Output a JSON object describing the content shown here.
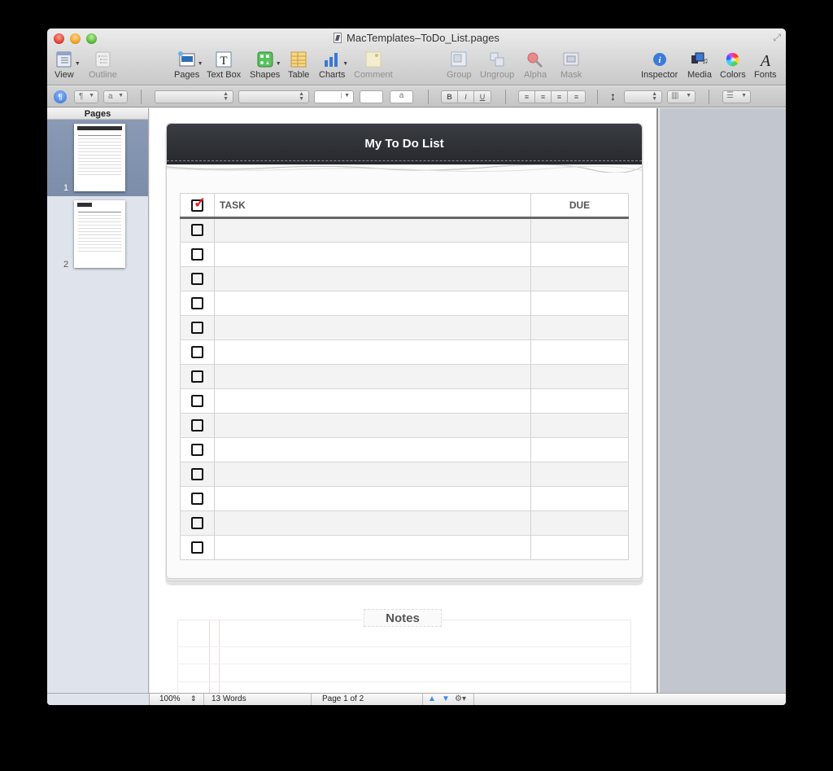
{
  "window": {
    "title": "MacTemplates–ToDo_List.pages"
  },
  "toolbar": {
    "items": [
      {
        "id": "view",
        "label": "View",
        "icon": "view-icon",
        "enabled": true,
        "menu": true
      },
      {
        "id": "outline",
        "label": "Outline",
        "icon": "outline-icon",
        "enabled": false,
        "menu": false
      },
      {
        "id": "pages",
        "label": "Pages",
        "icon": "pages-icon",
        "enabled": true,
        "menu": true
      },
      {
        "id": "textbox",
        "label": "Text Box",
        "icon": "text-box-icon",
        "enabled": true,
        "menu": false
      },
      {
        "id": "shapes",
        "label": "Shapes",
        "icon": "shapes-icon",
        "enabled": true,
        "menu": true
      },
      {
        "id": "table",
        "label": "Table",
        "icon": "table-icon",
        "enabled": true,
        "menu": false
      },
      {
        "id": "charts",
        "label": "Charts",
        "icon": "charts-icon",
        "enabled": true,
        "menu": true
      },
      {
        "id": "comment",
        "label": "Comment",
        "icon": "comment-icon",
        "enabled": false,
        "menu": false
      },
      {
        "id": "group",
        "label": "Group",
        "icon": "group-icon",
        "enabled": false,
        "menu": false
      },
      {
        "id": "ungroup",
        "label": "Ungroup",
        "icon": "ungroup-icon",
        "enabled": false,
        "menu": false
      },
      {
        "id": "alpha",
        "label": "Alpha",
        "icon": "alpha-icon",
        "enabled": false,
        "menu": false
      },
      {
        "id": "mask",
        "label": "Mask",
        "icon": "mask-icon",
        "enabled": false,
        "menu": false
      },
      {
        "id": "inspector",
        "label": "Inspector",
        "icon": "info-icon",
        "enabled": true,
        "menu": false
      },
      {
        "id": "media",
        "label": "Media",
        "icon": "media-icon",
        "enabled": true,
        "menu": false
      },
      {
        "id": "colors",
        "label": "Colors",
        "icon": "color-wheel-icon",
        "enabled": true,
        "menu": false
      },
      {
        "id": "fonts",
        "label": "Fonts",
        "icon": "fonts-icon",
        "enabled": true,
        "menu": false
      }
    ]
  },
  "format_bar": {
    "paragraph_style_glyph": "¶",
    "char_style_glyph": "a",
    "font_family_value": "",
    "font_typeface_value": "",
    "font_size_value": "",
    "text_color_value": "",
    "background_glyph": "a",
    "bold_label": "B",
    "italic_label": "I",
    "underline_label": "U",
    "line_spacing_value": ""
  },
  "sidebar": {
    "header": "Pages",
    "pages": [
      {
        "number": "1",
        "selected": true
      },
      {
        "number": "2",
        "selected": false
      }
    ]
  },
  "document": {
    "title": "My To Do List",
    "table": {
      "headers": {
        "check": "",
        "task": "TASK",
        "due": "DUE"
      },
      "header_checked": true,
      "rows": [
        {
          "checked": false,
          "task": "",
          "due": ""
        },
        {
          "checked": false,
          "task": "",
          "due": ""
        },
        {
          "checked": false,
          "task": "",
          "due": ""
        },
        {
          "checked": false,
          "task": "",
          "due": ""
        },
        {
          "checked": false,
          "task": "",
          "due": ""
        },
        {
          "checked": false,
          "task": "",
          "due": ""
        },
        {
          "checked": false,
          "task": "",
          "due": ""
        },
        {
          "checked": false,
          "task": "",
          "due": ""
        },
        {
          "checked": false,
          "task": "",
          "due": ""
        },
        {
          "checked": false,
          "task": "",
          "due": ""
        },
        {
          "checked": false,
          "task": "",
          "due": ""
        },
        {
          "checked": false,
          "task": "",
          "due": ""
        },
        {
          "checked": false,
          "task": "",
          "due": ""
        },
        {
          "checked": false,
          "task": "",
          "due": ""
        }
      ]
    },
    "notes_label": "Notes",
    "colors": {
      "header_bg": "#2b2d31",
      "check_red": "#e02020"
    }
  },
  "statusbar": {
    "zoom": "100%",
    "word_count": "13 Words",
    "page_indicator": "Page 1 of 2"
  }
}
